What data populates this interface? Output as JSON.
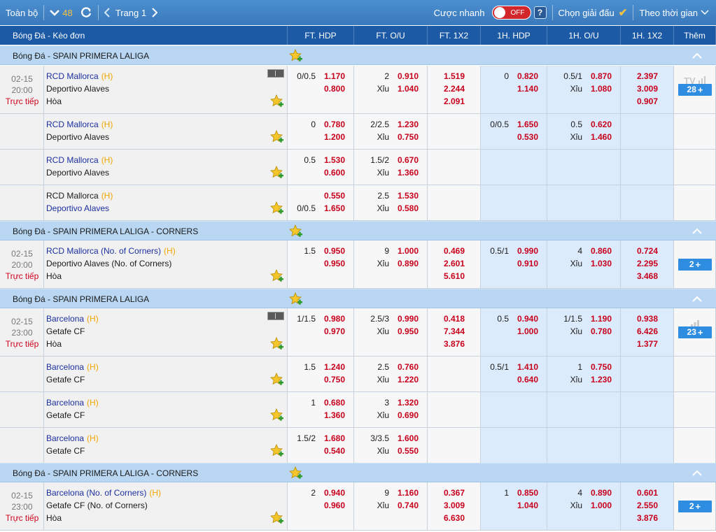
{
  "toolbar": {
    "all_label": "Toàn bộ",
    "count": "48",
    "page_label": "Trang 1",
    "quick_bet_label": "Cược nhanh",
    "toggle_label": "OFF",
    "help_label": "?",
    "choose_league_label": "Chọn giải đấu",
    "sort_label": "Theo thời gian"
  },
  "header": {
    "match": "Bóng Đá - Kèo đơn",
    "ft_hdp": "FT. HDP",
    "ft_ou": "FT. O/U",
    "ft_1x2": "FT. 1X2",
    "h1_hdp": "1H. HDP",
    "h1_ou": "1H. O/U",
    "h1_1x2": "1H. 1X2",
    "more": "Thêm"
  },
  "leagues": [
    {
      "name": "Bóng Đá - SPAIN PRIMERA LALIGA"
    },
    {
      "name": "Bóng Đá - SPAIN PRIMERA LALIGA - CORNERS"
    },
    {
      "name": "Bóng Đá - SPAIN PRIMERA LALIGA"
    },
    {
      "name": "Bóng Đá - SPAIN PRIMERA LALIGA - CORNERS"
    }
  ],
  "labels": {
    "home": "(H)",
    "draw": "Hòa",
    "under": "Xỉu",
    "live": "Trực tiếp",
    "tv": "TV"
  },
  "rows": [
    {
      "date": "02-15",
      "time": "20:00",
      "t1": "RCD Mallorca",
      "t2": "Deportivo Alaves",
      "ft_hdp": {
        "line1": "0/0.5",
        "o1": "1.170",
        "line2": "",
        "o2": "0.800"
      },
      "ft_ou": {
        "line": "2",
        "o1": "0.910",
        "o2": "1.040"
      },
      "ft_1x2": [
        "1.519",
        "2.244",
        "2.091"
      ],
      "h1_hdp": {
        "line1": "0",
        "o1": "0.820",
        "line2": "",
        "o2": "1.140"
      },
      "h1_ou": {
        "line": "0.5/1",
        "o1": "0.870",
        "o2": "1.080"
      },
      "h1_1x2": [
        "2.397",
        "3.009",
        "0.907"
      ],
      "more": "28"
    },
    {
      "t1": "RCD Mallorca",
      "t2": "Deportivo Alaves",
      "ft_hdp": {
        "line1": "0",
        "o1": "0.780",
        "line2": "",
        "o2": "1.200"
      },
      "ft_ou": {
        "line": "2/2.5",
        "o1": "1.230",
        "o2": "0.750"
      },
      "h1_hdp": {
        "line1": "0/0.5",
        "o1": "1.650",
        "line2": "",
        "o2": "0.530"
      },
      "h1_ou": {
        "line": "0.5",
        "o1": "0.620",
        "o2": "1.460"
      }
    },
    {
      "t1": "RCD Mallorca",
      "t2": "Deportivo Alaves",
      "ft_hdp": {
        "line1": "0.5",
        "o1": "1.530",
        "line2": "",
        "o2": "0.600"
      },
      "ft_ou": {
        "line": "1.5/2",
        "o1": "0.670",
        "o2": "1.360"
      }
    },
    {
      "t1": "RCD Mallorca",
      "t2": "Deportivo Alaves",
      "ft_hdp": {
        "line1": "",
        "o1": "0.550",
        "line2": "0/0.5",
        "o2": "1.650"
      },
      "ft_ou": {
        "line": "2.5",
        "o1": "1.530",
        "o2": "0.580"
      }
    },
    {
      "date": "02-15",
      "time": "20:00",
      "t1": "RCD Mallorca (No. of Corners)",
      "t2": "Deportivo Alaves (No. of Corners)",
      "ft_hdp": {
        "line1": "1.5",
        "o1": "0.950",
        "line2": "",
        "o2": "0.950"
      },
      "ft_ou": {
        "line": "9",
        "o1": "1.000",
        "o2": "0.890"
      },
      "ft_1x2": [
        "0.469",
        "2.601",
        "5.610"
      ],
      "h1_hdp": {
        "line1": "0.5/1",
        "o1": "0.990",
        "line2": "",
        "o2": "0.910"
      },
      "h1_ou": {
        "line": "4",
        "o1": "0.860",
        "o2": "1.030"
      },
      "h1_1x2": [
        "0.724",
        "2.295",
        "3.468"
      ],
      "more": "2"
    },
    {
      "date": "02-15",
      "time": "23:00",
      "t1": "Barcelona",
      "t2": "Getafe CF",
      "ft_hdp": {
        "line1": "1/1.5",
        "o1": "0.980",
        "line2": "",
        "o2": "0.970"
      },
      "ft_ou": {
        "line": "2.5/3",
        "o1": "0.990",
        "o2": "0.950"
      },
      "ft_1x2": [
        "0.418",
        "7.344",
        "3.876"
      ],
      "h1_hdp": {
        "line1": "0.5",
        "o1": "0.940",
        "line2": "",
        "o2": "1.000"
      },
      "h1_ou": {
        "line": "1/1.5",
        "o1": "1.190",
        "o2": "0.780"
      },
      "h1_1x2": [
        "0.938",
        "6.426",
        "1.377"
      ],
      "more": "23"
    },
    {
      "t1": "Barcelona",
      "t2": "Getafe CF",
      "ft_hdp": {
        "line1": "1.5",
        "o1": "1.240",
        "line2": "",
        "o2": "0.750"
      },
      "ft_ou": {
        "line": "2.5",
        "o1": "0.760",
        "o2": "1.220"
      },
      "h1_hdp": {
        "line1": "0.5/1",
        "o1": "1.410",
        "line2": "",
        "o2": "0.640"
      },
      "h1_ou": {
        "line": "1",
        "o1": "0.750",
        "o2": "1.230"
      }
    },
    {
      "t1": "Barcelona",
      "t2": "Getafe CF",
      "ft_hdp": {
        "line1": "1",
        "o1": "0.680",
        "line2": "",
        "o2": "1.360"
      },
      "ft_ou": {
        "line": "3",
        "o1": "1.320",
        "o2": "0.690"
      }
    },
    {
      "t1": "Barcelona",
      "t2": "Getafe CF",
      "ft_hdp": {
        "line1": "1.5/2",
        "o1": "1.680",
        "line2": "",
        "o2": "0.540"
      },
      "ft_ou": {
        "line": "3/3.5",
        "o1": "1.600",
        "o2": "0.550"
      }
    },
    {
      "date": "02-15",
      "time": "23:00",
      "t1": "Barcelona (No. of Corners)",
      "t2": "Getafe CF (No. of Corners)",
      "ft_hdp": {
        "line1": "2",
        "o1": "0.940",
        "line2": "",
        "o2": "0.960"
      },
      "ft_ou": {
        "line": "9",
        "o1": "1.160",
        "o2": "0.740"
      },
      "ft_1x2": [
        "0.367",
        "3.009",
        "6.630"
      ],
      "h1_hdp": {
        "line1": "1",
        "o1": "0.850",
        "line2": "",
        "o2": "1.040"
      },
      "h1_ou": {
        "line": "4",
        "o1": "0.890",
        "o2": "1.000"
      },
      "h1_1x2": [
        "0.601",
        "2.550",
        "3.876"
      ],
      "more": "2"
    }
  ]
}
